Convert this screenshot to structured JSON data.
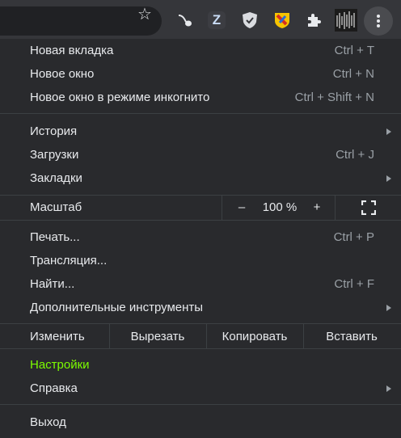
{
  "toolbar": {
    "star_icon": "star-outline-icon",
    "extensions": [
      {
        "name": "pipe-extension-icon"
      },
      {
        "name": "z-extension-icon",
        "text": "Z"
      },
      {
        "name": "shield-extension-icon"
      },
      {
        "name": "color-badge-extension-icon"
      },
      {
        "name": "puzzle-extensions-icon"
      },
      {
        "name": "profile-avatar"
      }
    ],
    "menu_icon": "three-dot-menu-icon"
  },
  "menu": {
    "new_tab": {
      "label": "Новая вкладка",
      "shortcut": "Ctrl + T"
    },
    "new_window": {
      "label": "Новое окно",
      "shortcut": "Ctrl + N"
    },
    "incognito": {
      "label": "Новое окно в режиме инкогнито",
      "shortcut": "Ctrl + Shift + N"
    },
    "history": {
      "label": "История"
    },
    "downloads": {
      "label": "Загрузки",
      "shortcut": "Ctrl + J"
    },
    "bookmarks": {
      "label": "Закладки"
    },
    "zoom": {
      "label": "Масштаб",
      "minus": "–",
      "value": "100 %",
      "plus": "+"
    },
    "print": {
      "label": "Печать...",
      "shortcut": "Ctrl + P"
    },
    "cast": {
      "label": "Трансляция..."
    },
    "find": {
      "label": "Найти...",
      "shortcut": "Ctrl + F"
    },
    "more_tools": {
      "label": "Дополнительные инструменты"
    },
    "edit": {
      "label": "Изменить",
      "cut": "Вырезать",
      "copy": "Копировать",
      "paste": "Вставить"
    },
    "settings": {
      "label": "Настройки",
      "color": "#7cfc00"
    },
    "help": {
      "label": "Справка"
    },
    "exit": {
      "label": "Выход"
    }
  }
}
